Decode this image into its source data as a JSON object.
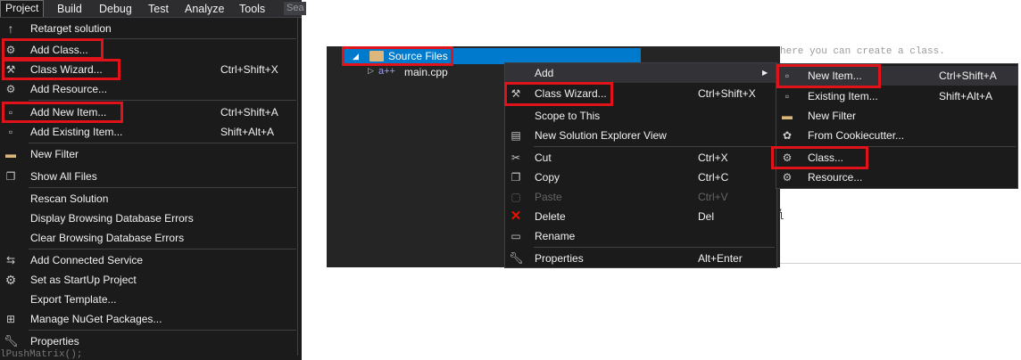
{
  "left_menu": {
    "menubar": {
      "items": [
        "Project",
        "Build",
        "Debug",
        "Test",
        "Analyze",
        "Tools"
      ],
      "search_text": "Sea"
    },
    "items": [
      {
        "label": "Retarget solution",
        "shortcut": "",
        "icon": "arrow-up-icon"
      },
      {
        "label": "Add Class...",
        "shortcut": "",
        "icon": "add-class-icon"
      },
      {
        "label": "Class Wizard...",
        "shortcut": "Ctrl+Shift+X",
        "icon": "class-wizard-icon"
      },
      {
        "label": "Add Resource...",
        "shortcut": "",
        "icon": "add-resource-icon"
      },
      {
        "label": "Add New Item...",
        "shortcut": "Ctrl+Shift+A",
        "icon": "new-item-icon"
      },
      {
        "label": "Add Existing Item...",
        "shortcut": "Shift+Alt+A",
        "icon": "existing-item-icon"
      },
      {
        "label": "New Filter",
        "shortcut": "",
        "icon": "folder-icon"
      },
      {
        "label": "Show All Files",
        "shortcut": "",
        "icon": "show-all-files-icon"
      },
      {
        "label": "Rescan Solution",
        "shortcut": "",
        "icon": ""
      },
      {
        "label": "Display Browsing Database Errors",
        "shortcut": "",
        "icon": ""
      },
      {
        "label": "Clear Browsing Database Errors",
        "shortcut": "",
        "icon": ""
      },
      {
        "label": "Add Connected Service",
        "shortcut": "",
        "icon": "connected-service-icon"
      },
      {
        "label": "Set as StartUp Project",
        "shortcut": "",
        "icon": "gear-icon"
      },
      {
        "label": "Export Template...",
        "shortcut": "",
        "icon": ""
      },
      {
        "label": "Manage NuGet Packages...",
        "shortcut": "",
        "icon": "nuget-icon"
      },
      {
        "label": "Properties",
        "shortcut": "",
        "icon": "wrench-icon"
      }
    ],
    "code_peek": "lPushMatrix();"
  },
  "solution_explorer": {
    "selected_node": "Source Files",
    "child_file": "main.cpp"
  },
  "context_menu": {
    "items": [
      {
        "label": "Add",
        "shortcut": "",
        "icon": "",
        "has_submenu": true
      },
      {
        "label": "Class Wizard...",
        "shortcut": "Ctrl+Shift+X",
        "icon": "class-wizard-icon"
      },
      {
        "label": "Scope to This",
        "shortcut": "",
        "icon": ""
      },
      {
        "label": "New Solution Explorer View",
        "shortcut": "",
        "icon": "new-view-icon"
      },
      {
        "label": "Cut",
        "shortcut": "Ctrl+X",
        "icon": "scissors-icon"
      },
      {
        "label": "Copy",
        "shortcut": "Ctrl+C",
        "icon": "copy-icon"
      },
      {
        "label": "Paste",
        "shortcut": "Ctrl+V",
        "icon": "paste-icon",
        "disabled": true
      },
      {
        "label": "Delete",
        "shortcut": "Del",
        "icon": "delete-icon"
      },
      {
        "label": "Rename",
        "shortcut": "",
        "icon": "rename-icon"
      },
      {
        "label": "Properties",
        "shortcut": "Alt+Enter",
        "icon": "wrench-icon"
      }
    ],
    "submenu_arrow": "▶"
  },
  "add_submenu": {
    "items": [
      {
        "label": "New Item...",
        "shortcut": "Ctrl+Shift+A",
        "icon": "new-item-icon"
      },
      {
        "label": "Existing Item...",
        "shortcut": "Shift+Alt+A",
        "icon": "existing-item-icon"
      },
      {
        "label": "New Filter",
        "shortcut": "",
        "icon": "folder-icon"
      },
      {
        "label": "From Cookiecutter...",
        "shortcut": "",
        "icon": "cookiecutter-icon"
      },
      {
        "label": "Class...",
        "shortcut": "",
        "icon": "add-class-icon"
      },
      {
        "label": "Resource...",
        "shortcut": "",
        "icon": "add-resource-icon"
      }
    ]
  },
  "background_code": {
    "top_line": "here you can create a class.",
    "fragments": [
      ",",
      "l"
    ]
  },
  "colors": {
    "highlight_box": "#e0131a",
    "selection": "#007acc",
    "menu_bg": "#1b1b1c"
  }
}
